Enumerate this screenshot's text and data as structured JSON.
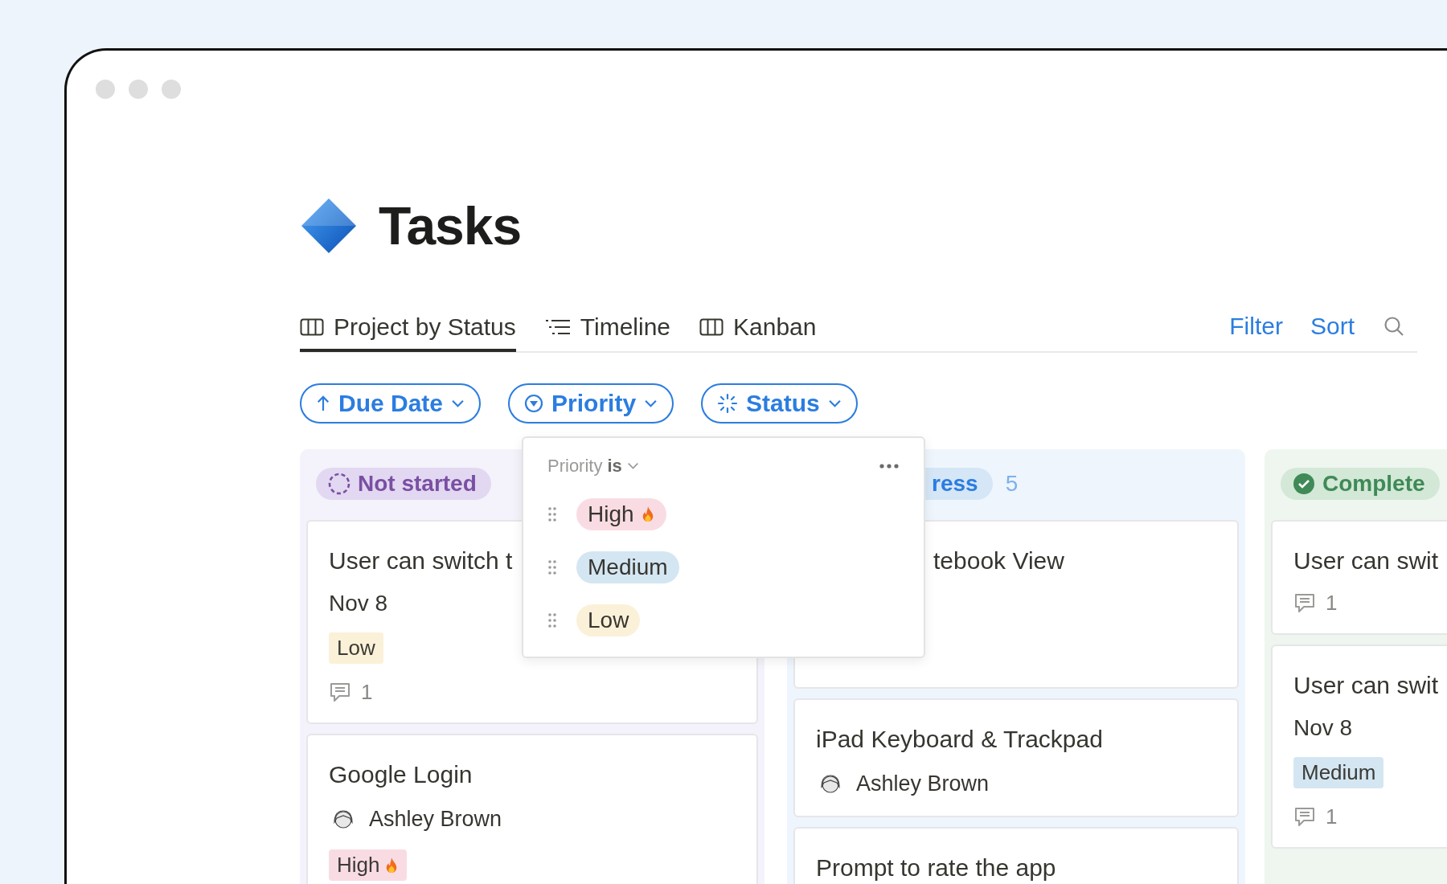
{
  "title": "Tasks",
  "tabs": [
    {
      "label": "Project by Status",
      "kind": "board",
      "selected": true
    },
    {
      "label": "Timeline",
      "kind": "timeline",
      "selected": false
    },
    {
      "label": "Kanban",
      "kind": "board",
      "selected": false
    }
  ],
  "actions": [
    "Filter",
    "Sort"
  ],
  "chips": [
    {
      "label": "Due Date",
      "kind": "sort"
    },
    {
      "label": "Priority",
      "kind": "priority"
    },
    {
      "label": "Status",
      "kind": "status"
    }
  ],
  "columns": [
    {
      "label": "Not started",
      "kind": "not_started",
      "cards": [
        {
          "title": "User can switch t",
          "date": "Nov 8",
          "tag": {
            "label": "Low",
            "kind": "low"
          },
          "comments": "1"
        },
        {
          "title": "Google Login",
          "assignee": "Ashley Brown",
          "tag": {
            "label": "High",
            "kind": "high"
          }
        }
      ]
    },
    {
      "label": "ress",
      "count": "5",
      "kind": "in_progress",
      "cards": [
        {
          "title": "tebook View",
          "covered": true
        },
        {
          "title": "iPad Keyboard & Trackpad",
          "assignee": "Ashley Brown"
        },
        {
          "title": "Prompt to rate the app"
        }
      ]
    },
    {
      "label": "Complete",
      "kind": "complete",
      "cards": [
        {
          "title": "User can swit",
          "comments": "1"
        },
        {
          "title": "User can swit",
          "date": "Nov 8",
          "tag": {
            "label": "Medium",
            "kind": "medium"
          },
          "comments": "1"
        }
      ]
    }
  ],
  "filter_menu": {
    "field": "Priority",
    "operator": "is",
    "options": [
      {
        "label": "High",
        "kind": "high"
      },
      {
        "label": "Medium",
        "kind": "medium"
      },
      {
        "label": "Low",
        "kind": "low"
      }
    ]
  }
}
